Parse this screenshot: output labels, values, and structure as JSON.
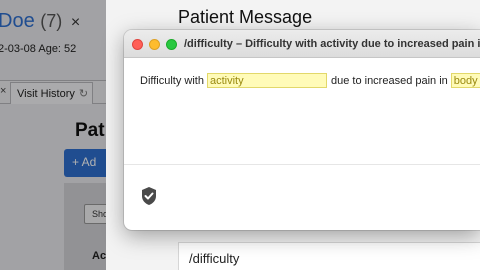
{
  "patient": {
    "name": "Doe",
    "count": "(7)",
    "close_glyph": "×",
    "meta": "2-03-08 Age: 52"
  },
  "tabs": {
    "close_glyph": "×",
    "visit_history": "Visit History",
    "refresh_glyph": "↻"
  },
  "main": {
    "heading": "Pat",
    "add_button": "+ Ad",
    "show_button": "Sho",
    "section_label": "Ac"
  },
  "patient_message": {
    "title": "Patient Message",
    "input_value": "/difficulty"
  },
  "popup": {
    "title": "/difficulty – Difficulty with activity due to increased pain in body part",
    "text_prefix": "Difficulty with",
    "field_activity": "activity",
    "text_middle": "due to increased pain in",
    "field_body_part": "body pa",
    "footer_icon": "shield-check-icon"
  },
  "colors": {
    "accent": "#2f6fcf",
    "field_fill": "#fffbb8",
    "close": "#ff5f57",
    "minimize": "#febc2e",
    "zoom": "#28c840"
  }
}
